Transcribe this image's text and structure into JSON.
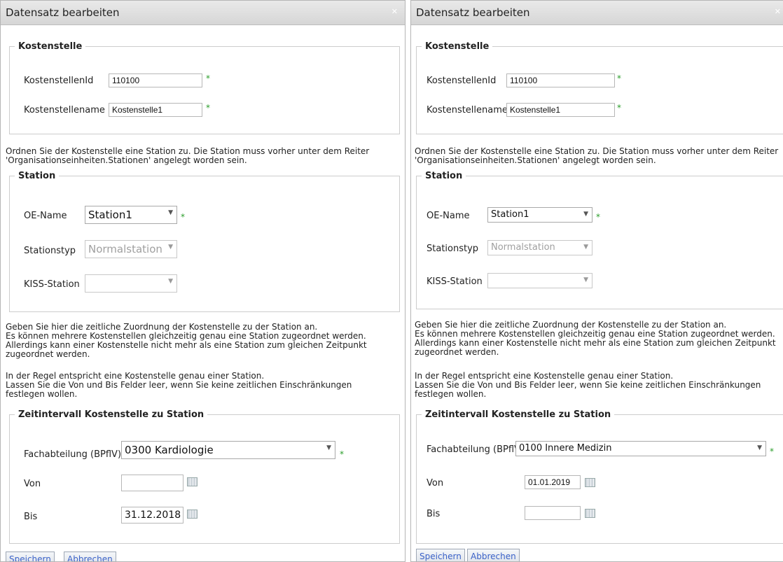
{
  "left": {
    "title": "Datensatz bearbeiten",
    "close": "✕",
    "kostenstelle": {
      "legend": "Kostenstelle",
      "id_label": "KostenstellenId",
      "id_value": "110100",
      "name_label": "Kostenstellename",
      "name_value": "Kostenstelle1",
      "required": "*"
    },
    "info1": "Ordnen Sie der Kostenstelle eine Station zu. Die Station muss vorher unter dem Reiter\n'Organisationseinheiten.Stationen' angelegt worden sein.",
    "station": {
      "legend": "Station",
      "oe_label": "OE-Name",
      "oe_value": "Station1",
      "typ_label": "Stationstyp",
      "typ_value": "Normalstation",
      "kiss_label": "KISS-Station",
      "kiss_value": ""
    },
    "info2": "Geben Sie hier die zeitliche Zuordnung der Kostenstelle zu der Station an.\nEs können mehrere Kostenstellen gleichzeitig genau eine Station zugeordnet werden.\nAllerdings kann einer Kostenstelle nicht mehr als eine Station zum gleichen Zeitpunkt\nzugeordnet werden.",
    "info3": "In der Regel entspricht eine Kostenstelle genau einer Station.\nLassen Sie die Von und Bis Felder leer, wenn Sie keine zeitlichen Einschränkungen\nfestlegen wollen.",
    "zeit": {
      "legend": "Zeitintervall Kostenstelle zu Station",
      "fach_label": "Fachabteilung (BPflV)",
      "fach_value": "0300 Kardiologie",
      "von_label": "Von",
      "von_value": "",
      "bis_label": "Bis",
      "bis_value": "31.12.2018"
    },
    "save": "Speichern",
    "cancel": "Abbrechen"
  },
  "right": {
    "title": "Datensatz bearbeiten",
    "close": "✕",
    "kostenstelle": {
      "legend": "Kostenstelle",
      "id_label": "KostenstellenId",
      "id_value": "110100",
      "name_label": "Kostenstellename",
      "name_value": "Kostenstelle1",
      "required": "*"
    },
    "info1": "Ordnen Sie der Kostenstelle eine Station zu. Die Station muss vorher unter dem Reiter\n'Organisationseinheiten.Stationen' angelegt worden sein.",
    "station": {
      "legend": "Station",
      "oe_label": "OE-Name",
      "oe_value": "Station1",
      "typ_label": "Stationstyp",
      "typ_value": "Normalstation",
      "kiss_label": "KISS-Station",
      "kiss_value": ""
    },
    "info2": "Geben Sie hier die zeitliche Zuordnung der Kostenstelle zu der Station an.\nEs können mehrere Kostenstellen gleichzeitig genau eine Station zugeordnet werden.\nAllerdings kann einer Kostenstelle nicht mehr als eine Station zum gleichen Zeitpunkt\nzugeordnet werden.",
    "info3": "In der Regel entspricht eine Kostenstelle genau einer Station.\nLassen Sie die Von und Bis Felder leer, wenn Sie keine zeitlichen Einschränkungen\nfestlegen wollen.",
    "zeit": {
      "legend": "Zeitintervall Kostenstelle zu Station",
      "fach_label": "Fachabteilung (BPflV)",
      "fach_value": "0100 Innere Medizin",
      "von_label": "Von",
      "von_value": "01.01.2019",
      "bis_label": "Bis",
      "bis_value": ""
    },
    "save": "Speichern",
    "cancel": "Abbrechen"
  },
  "icons": {
    "dropdown": "chevron-down-icon",
    "calendar": "calendar-icon"
  }
}
